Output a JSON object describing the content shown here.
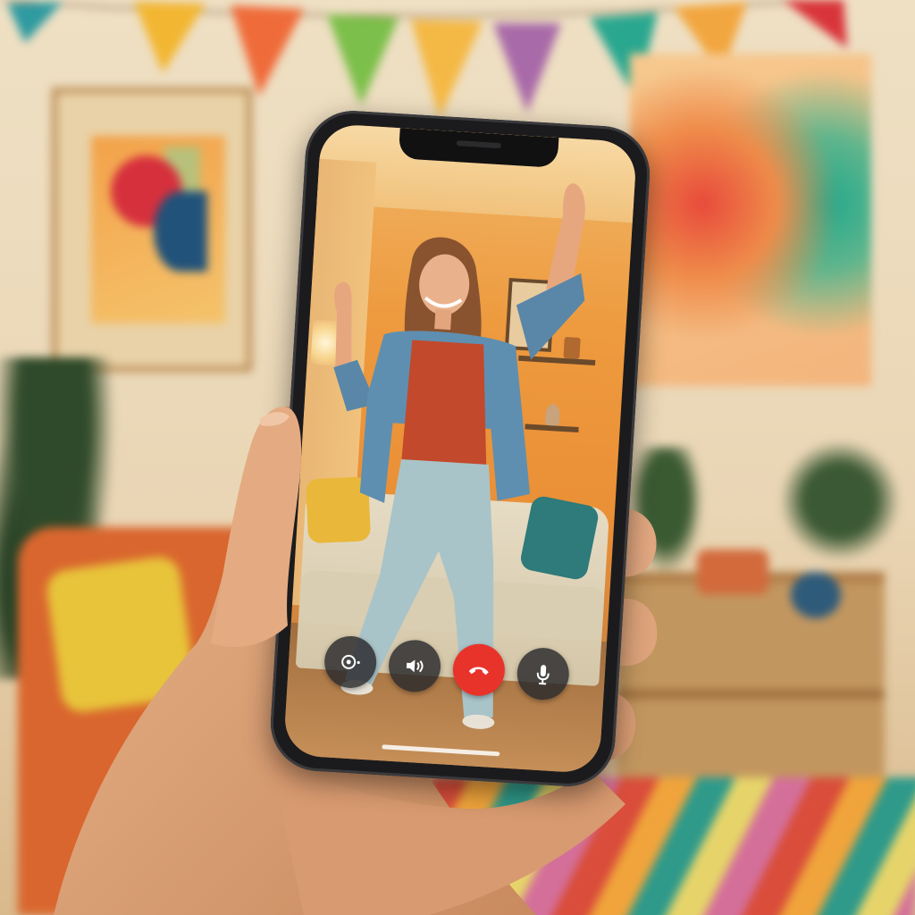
{
  "scene": {
    "colors": {
      "wall": "#efe0c4",
      "sofa_background": "#d9662e",
      "accent_orange_wall": "#ee9a3e",
      "end_call_red": "#e8332b",
      "control_button_dark": "#28282c"
    },
    "bunting_flag_colors": [
      "#2f9aa0",
      "#f2b632",
      "#ef6b3a",
      "#7cbf4a",
      "#f4b844",
      "#a86aa8",
      "#2aa78f",
      "#f2a640",
      "#d8353b"
    ]
  },
  "call_screen": {
    "controls": [
      {
        "name": "camera-switch",
        "icon": "camera-rotate-icon"
      },
      {
        "name": "speaker",
        "icon": "speaker-icon"
      },
      {
        "name": "end-call",
        "icon": "phone-hangup-icon"
      },
      {
        "name": "microphone",
        "icon": "microphone-icon"
      }
    ]
  }
}
